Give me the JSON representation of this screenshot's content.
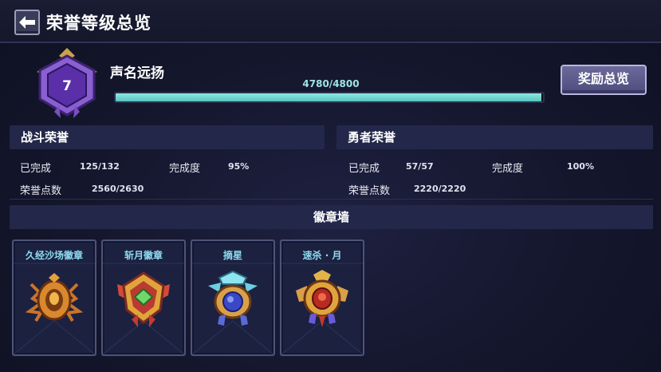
{
  "header": {
    "title": "荣誉等级总览",
    "back_icon": "back-arrow-icon"
  },
  "rank": {
    "level": "7",
    "name": "声名远扬",
    "exp_text": "4780/4800",
    "exp_progress": 0.9958
  },
  "reward_button": {
    "label": "奖励总览"
  },
  "battle_honor": {
    "title": "战斗荣誉",
    "completed_label": "已完成",
    "completed_value": "125/132",
    "completion_label": "完成度",
    "completion_value": "95%",
    "points_label": "荣誉点数",
    "points_value": "2560/2630"
  },
  "hero_honor": {
    "title": "勇者荣誉",
    "completed_label": "已完成",
    "completed_value": "57/57",
    "completion_label": "完成度",
    "completion_value": "100%",
    "points_label": "荣誉点数",
    "points_value": "2220/2220"
  },
  "badge_wall": {
    "title": "徽章墙",
    "badges": [
      {
        "name": "久经沙场徽章",
        "icon": "spider-badge-icon"
      },
      {
        "name": "斩月徽章",
        "icon": "emerald-crest-badge-icon"
      },
      {
        "name": "摘星",
        "icon": "sapphire-star-badge-icon"
      },
      {
        "name": "速杀 · 月",
        "icon": "ruby-moon-badge-icon"
      }
    ]
  },
  "colors": {
    "accent_teal": "#56c4c0",
    "badge_title": "#8fdcf0",
    "section_bg": "#23284a",
    "rank_purple": "#6a3fb8"
  }
}
